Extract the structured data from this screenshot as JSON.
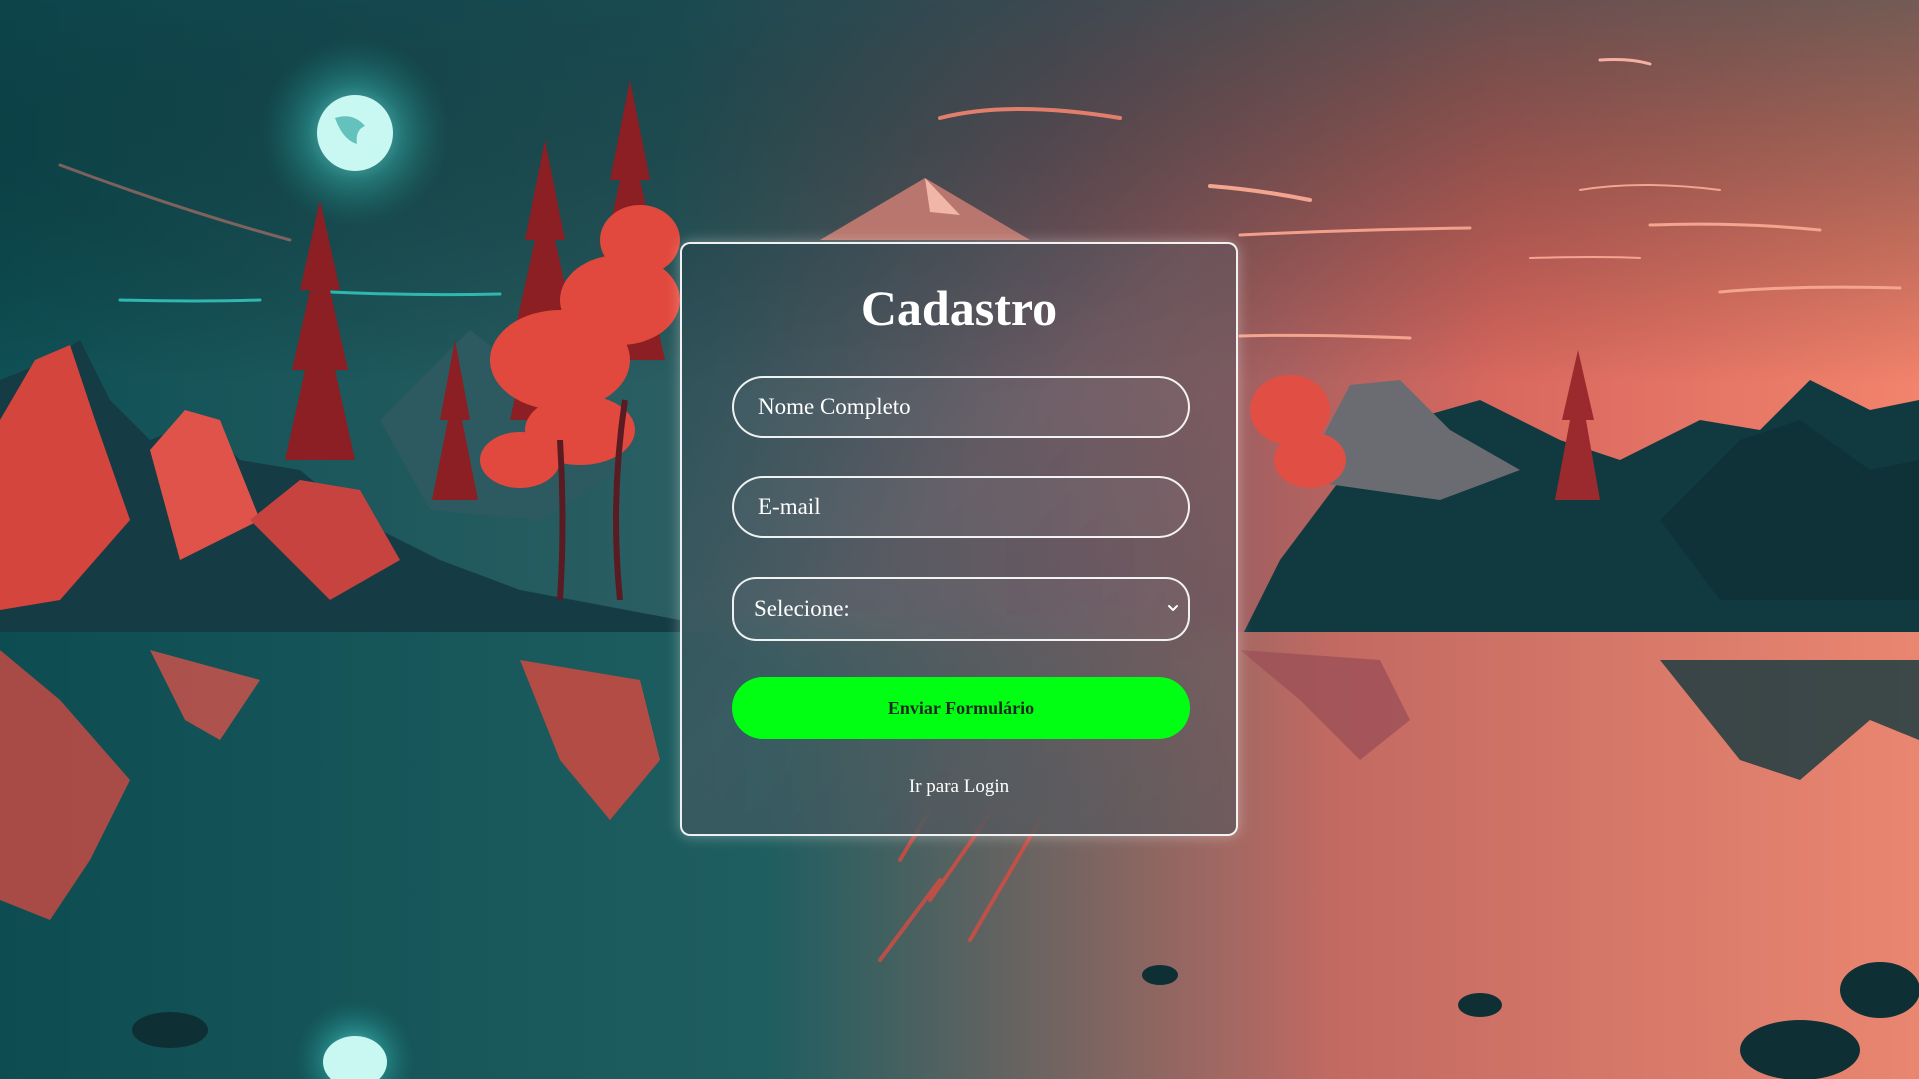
{
  "form": {
    "title": "Cadastro",
    "name_placeholder": "Nome Completo",
    "email_placeholder": "E-mail",
    "select_selected": "Selecione:",
    "submit_label": "Enviar Formulário",
    "login_link_label": "Ir para Login"
  },
  "colors": {
    "submit_button": "#00ff12",
    "card_border": "#ffffff",
    "sky_left": "#0f5a5e",
    "sky_right": "#f07a6a"
  },
  "icons": {
    "select_arrow": "chevron-down-icon"
  }
}
